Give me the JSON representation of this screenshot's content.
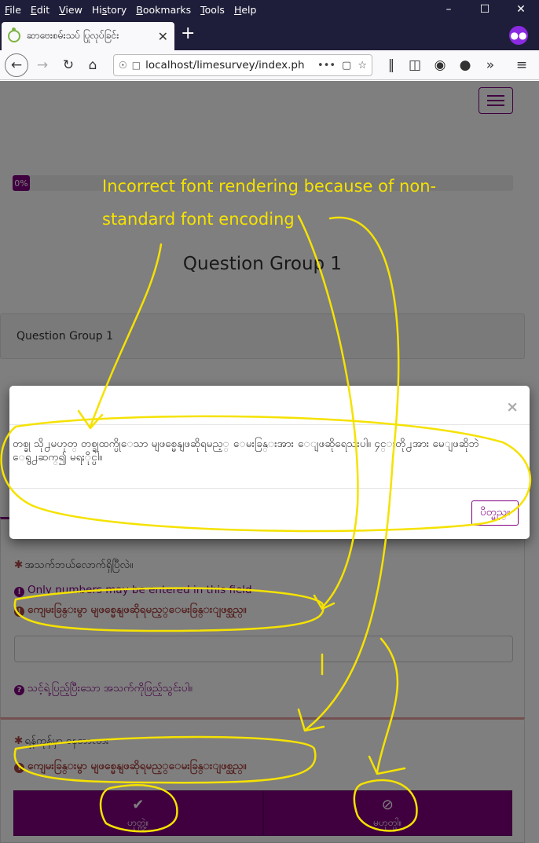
{
  "browser": {
    "menu": [
      "File",
      "Edit",
      "View",
      "History",
      "Bookmarks",
      "Tools",
      "Help"
    ],
    "menu_underline": [
      "F",
      "E",
      "V",
      "s",
      "B",
      "T",
      "H"
    ],
    "tab_title": "ဆာဗေးစမ်းသပ် ပြုလုပ်ခြင်း",
    "url": "localhost/limesurvey/index.ph",
    "url_more": "•••"
  },
  "page": {
    "progress_label": "0%",
    "progress_value": 0,
    "group_title": "Question Group 1",
    "group_description": "Question Group 1",
    "q1": {
      "text": "အသက်ဘယ်လောက်ရှိပြီလဲ။",
      "tip_numbers": "Only numbers may be entered in this field",
      "error": "ကျေမးခြန္းမွာ မျဖစ္မေနျဖဆိုရမည့္ေမးခြန္းျဖစ္သည္။",
      "help": "သင့်ရဲ့ပြည့်ပြီးသော အသက်ကိုဖြည့်သွင်းပါ။"
    },
    "q2": {
      "text": "ရန်ကုန်မှာ နေတာလား",
      "error": "ကျေမးခြန္းမွာ မျဖစ္မေနျဖဆိုရမည့္ေမးခြန္းျဖစ္သည္။",
      "yes_label": "ဟုတ္ကဲ့။",
      "no_label": "မဟုတ္ပါ။"
    }
  },
  "modal": {
    "close": "×",
    "body": "တစ္ခု သို႕မဟုတ္ တစ္ခုထက္ပိုေသာ မျဖစ္မေနျဖဆိုရမည့္ ေမးခြန္းအား ေျဖဆိုရေသးပါ။ ၄င္းတို႕အား မေျဖဆိုဘဲ ေရွ႕ဆက္၍ မရႏိုင္ပါ။",
    "ok": "ပိတ္မည္။"
  },
  "annotation": {
    "line1": "Incorrect font rendering because of non-",
    "line2": "standard font encoding",
    "color": "#f5e200"
  }
}
